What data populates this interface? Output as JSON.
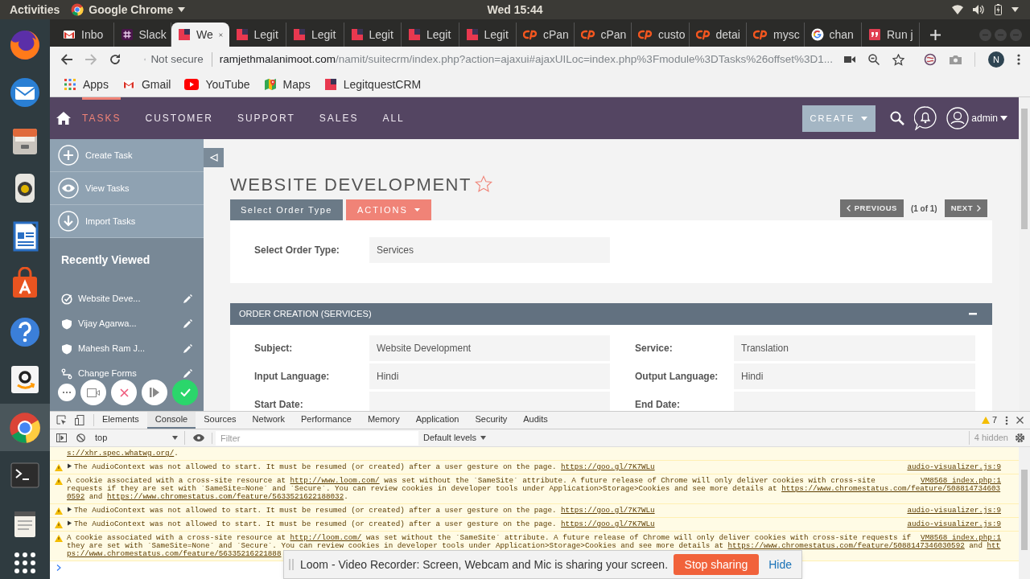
{
  "top_bar": {
    "activities": "Activities",
    "app_menu": "Google Chrome",
    "clock": "Wed 15:44"
  },
  "browser": {
    "tabs": [
      {
        "title": "Inbo",
        "kind": "gmail",
        "selected": false
      },
      {
        "title": "Slack",
        "kind": "slack",
        "selected": false
      },
      {
        "title": "We",
        "kind": "suite",
        "selected": true
      },
      {
        "title": "Legit",
        "kind": "suite",
        "selected": false
      },
      {
        "title": "Legit",
        "kind": "suite",
        "selected": false
      },
      {
        "title": "Legit",
        "kind": "suite",
        "selected": false
      },
      {
        "title": "Legit",
        "kind": "suite",
        "selected": false
      },
      {
        "title": "Legit",
        "kind": "suite",
        "selected": false
      },
      {
        "title": "cPan",
        "kind": "cpanel",
        "selected": false
      },
      {
        "title": "cPan",
        "kind": "cpanel",
        "selected": false
      },
      {
        "title": "custo",
        "kind": "cpanel",
        "selected": false
      },
      {
        "title": "detai",
        "kind": "cpanel",
        "selected": false
      },
      {
        "title": "mysc",
        "kind": "cpanel",
        "selected": false
      },
      {
        "title": "chan",
        "kind": "google",
        "selected": false
      },
      {
        "title": "Run j",
        "kind": "quote",
        "selected": false
      }
    ],
    "toolbar": {
      "security": "Not secure",
      "url_host": "ramjethmalanimoot.com",
      "url_path": "/namit/suitecrm/index.php?action=ajaxui#ajaxUILoc=index.php%3Fmodule%3DTasks%26offset%3D1...",
      "profile": "N"
    },
    "bookmarks": [
      {
        "label": "Apps",
        "kind": "apps"
      },
      {
        "label": "Gmail",
        "kind": "gmail"
      },
      {
        "label": "YouTube",
        "kind": "youtube"
      },
      {
        "label": "Maps",
        "kind": "maps"
      },
      {
        "label": "LegitquestCRM",
        "kind": "suite"
      }
    ]
  },
  "crm": {
    "nav": [
      {
        "label": "TASKS",
        "selected": true
      },
      {
        "label": "CUSTOMER",
        "selected": false
      },
      {
        "label": "SUPPORT",
        "selected": false
      },
      {
        "label": "SALES",
        "selected": false
      },
      {
        "label": "ALL",
        "selected": false
      }
    ],
    "create": "CREATE",
    "user": "admin",
    "actions": [
      {
        "label": "Create Task",
        "kind": "plus"
      },
      {
        "label": "View Tasks",
        "kind": "eye"
      },
      {
        "label": "Import Tasks",
        "kind": "import"
      }
    ],
    "recently_viewed": {
      "title": "Recently Viewed",
      "items": [
        {
          "label": "Website Deve...",
          "kind": "task"
        },
        {
          "label": "Vijay Agarwa...",
          "kind": "shield"
        },
        {
          "label": "Mahesh Ram J...",
          "kind": "shield"
        },
        {
          "label": "Change Forms",
          "kind": "flow"
        }
      ]
    },
    "record": {
      "title": "WEBSITE DEVELOPMENT",
      "favorite": false,
      "buttons": [
        {
          "label": "Select Order Type",
          "kind": "tab"
        },
        {
          "label": "ACTIONS",
          "kind": "menu"
        }
      ],
      "pager": {
        "previous": "PREVIOUS",
        "position": "(1 of 1)",
        "next": "NEXT"
      },
      "order_type_panel": {
        "fields": [
          {
            "label": "Select Order Type:",
            "value": "Services"
          }
        ]
      },
      "order_creation_panel": {
        "title": "ORDER CREATION (SERVICES)",
        "expanded": true,
        "fields": [
          {
            "label": "Subject:",
            "value": "Website Development"
          },
          {
            "label": "Service:",
            "value": "Translation"
          },
          {
            "label": "Input Language:",
            "value": "Hindi"
          },
          {
            "label": "Output Language:",
            "value": "Hindi"
          },
          {
            "label": "Start Date:"
          },
          {
            "label": "End Date:"
          }
        ]
      }
    }
  },
  "devtools": {
    "tabs": [
      {
        "label": "Elements",
        "selected": false
      },
      {
        "label": "Console",
        "selected": true
      },
      {
        "label": "Sources",
        "selected": false
      },
      {
        "label": "Network",
        "selected": false
      },
      {
        "label": "Performance",
        "selected": false
      },
      {
        "label": "Memory",
        "selected": false
      },
      {
        "label": "Application",
        "selected": false
      },
      {
        "label": "Security",
        "selected": false
      },
      {
        "label": "Audits",
        "selected": false
      }
    ],
    "warnings": "7",
    "context": "top",
    "filter_placeholder": "Filter",
    "levels": "Default levels",
    "hidden": "4 hidden",
    "messages": [
      {
        "kind": "fragment",
        "expandable": false,
        "lines": [
          [
            {
              "kind": "link",
              "text": "s://xhr.spec.whatwg.org/"
            },
            {
              "kind": "text",
              "text": "."
            }
          ]
        ]
      },
      {
        "kind": "warning",
        "expandable": true,
        "source": "audio-visualizer.js:9",
        "lines": [
          [
            {
              "kind": "text",
              "text": "The AudioContext was not allowed to start. It must be resumed (or created) after a user gesture on the page. "
            },
            {
              "kind": "link",
              "text": "https://goo.gl/7K7WLu"
            }
          ]
        ]
      },
      {
        "kind": "warning",
        "expandable": false,
        "source": "VM8568 index.php:1",
        "lines": [
          [
            {
              "kind": "text",
              "text": "A cookie associated with a cross-site resource at "
            },
            {
              "kind": "link",
              "text": "http://www.loom.com/"
            },
            {
              "kind": "text",
              "text": " was set without the `SameSite` attribute. A future release of Chrome will only deliver cookies with cross-site"
            }
          ],
          [
            {
              "kind": "text",
              "text": "requests if they are set with `SameSite=None` and `Secure`. You can review cookies in developer tools under Application>Storage>Cookies and see more details at "
            },
            {
              "kind": "link",
              "text": "https://www.chromestatus.com/feature/508814734603"
            }
          ],
          [
            {
              "kind": "link",
              "text": "0592"
            },
            {
              "kind": "text",
              "text": " and "
            },
            {
              "kind": "link",
              "text": "https://www.chromestatus.com/feature/5633521622188032"
            },
            {
              "kind": "text",
              "text": "."
            }
          ]
        ]
      },
      {
        "kind": "warning",
        "expandable": true,
        "source": "audio-visualizer.js:9",
        "lines": [
          [
            {
              "kind": "text",
              "text": "The AudioContext was not allowed to start. It must be resumed (or created) after a user gesture on the page. "
            },
            {
              "kind": "link",
              "text": "https://goo.gl/7K7WLu"
            }
          ]
        ]
      },
      {
        "kind": "warning",
        "expandable": true,
        "source": "audio-visualizer.js:9",
        "lines": [
          [
            {
              "kind": "text",
              "text": "The AudioContext was not allowed to start. It must be resumed (or created) after a user gesture on the page. "
            },
            {
              "kind": "link",
              "text": "https://goo.gl/7K7WLu"
            }
          ]
        ]
      },
      {
        "kind": "warning",
        "expandable": false,
        "source": "VM8568 index.php:1",
        "lines": [
          [
            {
              "kind": "text",
              "text": "A cookie associated with a cross-site resource at "
            },
            {
              "kind": "link",
              "text": "http://loom.com/"
            },
            {
              "kind": "text",
              "text": " was set without the `SameSite` attribute. A future release of Chrome will only deliver cookies with cross-site requests if"
            }
          ],
          [
            {
              "kind": "text",
              "text": "they are set with `SameSite=None` and `Secure`. You can review cookies in developer tools under Application>Storage>Cookies and see more details at "
            },
            {
              "kind": "link",
              "text": "https://www.chromestatus.com/feature/5088147346030592"
            },
            {
              "kind": "text",
              "text": " and "
            },
            {
              "kind": "link",
              "text": "htt"
            }
          ],
          [
            {
              "kind": "link",
              "text": "ps://www.chromestatus.com/feature/56335216221888"
            }
          ]
        ]
      }
    ]
  },
  "loom_banner": {
    "message": "Loom - Video Recorder: Screen, Webcam and Mic is sharing your screen.",
    "stop": "Stop sharing",
    "hide": "Hide"
  }
}
